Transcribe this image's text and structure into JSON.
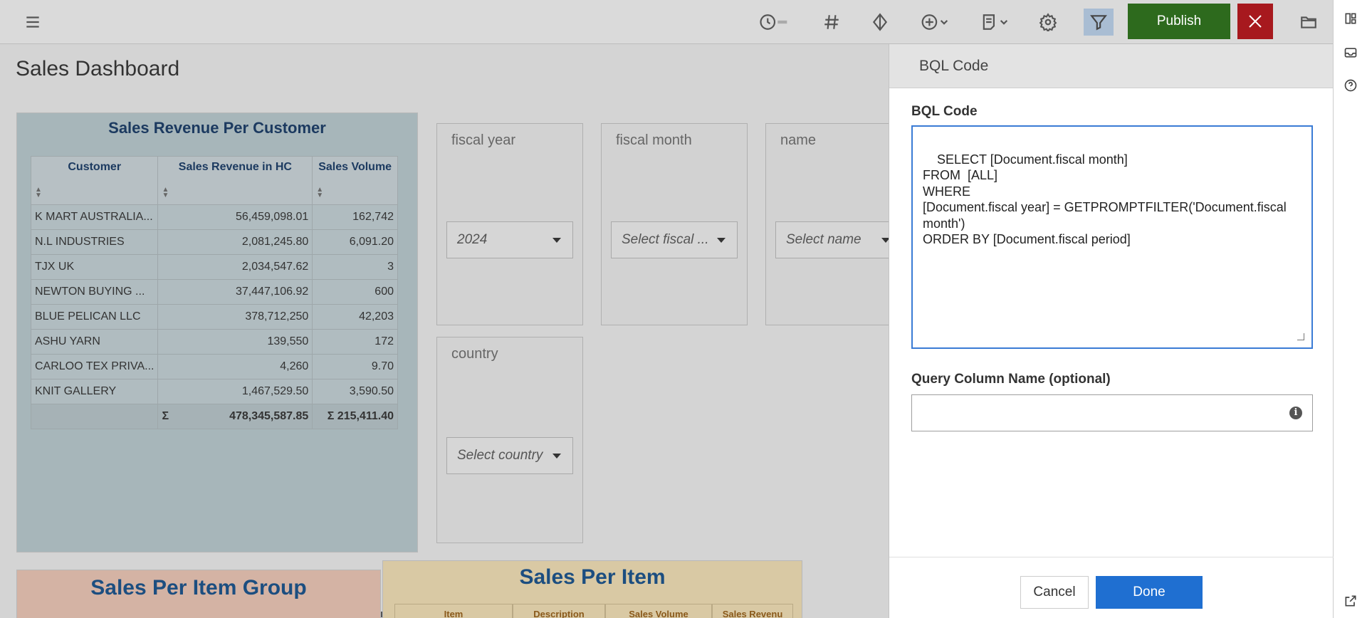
{
  "toolbar": {
    "icons": [
      "menu-icon",
      "history-icon",
      "hashtag-icon",
      "diamond-icon",
      "add-icon",
      "page-icon",
      "settings-icon",
      "filter-icon",
      "folder-icon"
    ],
    "publish_label": "Publish",
    "colors": {
      "publish": "#2d6a1d",
      "close": "#a7191e",
      "filter_active": "#a9bdd3"
    }
  },
  "rail": {
    "icons": [
      "layout-icon",
      "inbox-icon",
      "help-icon",
      "external-link-icon"
    ]
  },
  "page": {
    "title": "Sales Dashboard"
  },
  "customer_panel": {
    "title": "Sales Revenue Per Customer",
    "columns": [
      "Customer",
      "Sales Revenue in HC",
      "Sales Volume"
    ],
    "rows": [
      [
        "K MART AUSTRALIA...",
        "56,459,098.01",
        "162,742"
      ],
      [
        "N.L INDUSTRIES",
        "2,081,245.80",
        "6,091.20"
      ],
      [
        "TJX UK",
        "2,034,547.62",
        "3"
      ],
      [
        "NEWTON BUYING ...",
        "37,447,106.92",
        "600"
      ],
      [
        "BLUE PELICAN LLC",
        "378,712,250",
        "42,203"
      ],
      [
        "ASHU YARN",
        "139,550",
        "172"
      ],
      [
        "CARLOO TEX PRIVA...",
        "4,260",
        "9.70"
      ],
      [
        "KNIT GALLERY",
        "1,467,529.50",
        "3,590.50"
      ]
    ],
    "total": {
      "sum_symbol": "Σ",
      "revenue": "478,345,587.85",
      "volume": "Σ 215,411.40"
    }
  },
  "filters": {
    "fiscal_year": {
      "label": "fiscal year",
      "value": "2024"
    },
    "fiscal_month": {
      "label": "fiscal month",
      "value": "Select fiscal ..."
    },
    "name": {
      "label": "name",
      "value": "Select name"
    },
    "country": {
      "label": "country",
      "value": "Select country"
    }
  },
  "item_group_panel": {
    "title": "Sales Per Item Group"
  },
  "item_panel": {
    "title": "Sales Per Item",
    "columns": [
      "Item",
      "Description",
      "Sales Volume",
      "Sales Revenu"
    ]
  },
  "bql": {
    "header": "BQL Code",
    "code_label": "BQL Code",
    "code": "SELECT [Document.fiscal month]\nFROM  [ALL]\nWHERE\n[Document.fiscal year] = GETPROMPTFILTER('Document.fiscal month')\nORDER BY [Document.fiscal period]",
    "column_name_label": "Query Column Name (optional)",
    "column_name_value": "",
    "cancel_label": "Cancel",
    "done_label": "Done"
  }
}
